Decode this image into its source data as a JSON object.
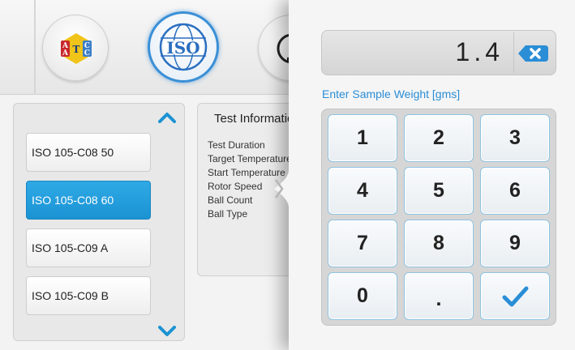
{
  "header": {
    "standards": [
      {
        "name": "AATCC",
        "letters": [
          "A",
          "A",
          "T",
          "C",
          "C"
        ],
        "colors": {
          "red": "#c8282e",
          "yellow": "#f0c419",
          "blue": "#3b7ec8"
        }
      },
      {
        "name": "ISO",
        "label": "ISO",
        "accent": "#2a6fc0"
      },
      {
        "name": "third-standard"
      }
    ]
  },
  "test_list": {
    "items": [
      {
        "label": "ISO  105-C08  50",
        "selected": false
      },
      {
        "label": "ISO  105-C08  60",
        "selected": true
      },
      {
        "label": "ISO  105-C09  A",
        "selected": false
      },
      {
        "label": "ISO  105-C09  B",
        "selected": false
      }
    ],
    "accent_color": "#1b93d3"
  },
  "test_info": {
    "title": "Test Information",
    "fields": [
      "Test Duration",
      "Target Temperature",
      "Start Temperature",
      "Rotor Speed",
      "Ball Count",
      "Ball Type"
    ]
  },
  "keypad": {
    "display_value": "1.4",
    "entry_label": "Enter Sample Weight [gms]",
    "keys": [
      "1",
      "2",
      "3",
      "4",
      "5",
      "6",
      "7",
      "8",
      "9",
      "0",
      ".",
      "confirm"
    ],
    "accent_color": "#2a8ed6",
    "icons": {
      "backspace": "backspace-icon",
      "confirm": "check-icon"
    }
  }
}
